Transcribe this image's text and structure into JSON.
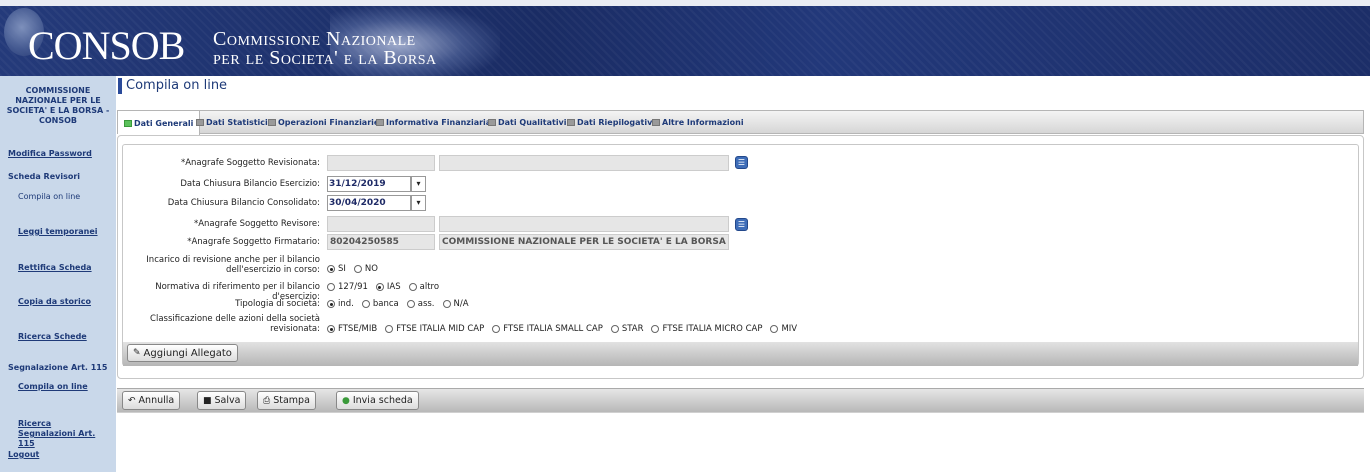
{
  "header": {
    "logo_text": "CONSOB",
    "subtitle_line1": "Commissione Nazionale",
    "subtitle_line2": "per le Societa' e la Borsa"
  },
  "sidebar": {
    "org_title": "COMMISSIONE NAZIONALE PER LE SOCIETA' E LA BORSA - CONSOB",
    "items": [
      {
        "label": "Modifica Password"
      },
      {
        "label": "Scheda Revisori"
      },
      {
        "label": "Compila on line"
      },
      {
        "label": "Leggi temporanei"
      },
      {
        "label": "Rettifica Scheda"
      },
      {
        "label": "Copia da storico"
      },
      {
        "label": "Ricerca Schede"
      },
      {
        "label": "Segnalazione Art. 115"
      },
      {
        "label": "Compila on line"
      },
      {
        "label": "Ricerca Segnalazioni Art. 115"
      },
      {
        "label": "Logout"
      }
    ]
  },
  "page": {
    "title": "Compila on line"
  },
  "tabs": [
    {
      "label": "Dati Generali",
      "active": true
    },
    {
      "label": "Dati Statistici"
    },
    {
      "label": "Operazioni Finanziarie"
    },
    {
      "label": "Informativa Finanziaria"
    },
    {
      "label": "Dati Qualitativi"
    },
    {
      "label": "Dati Riepilogativi"
    },
    {
      "label": "Altre Informazioni"
    }
  ],
  "form": {
    "anagrafe_revisionata_label": "*Anagrafe Soggetto Revisionata:",
    "data_chiusura_esercizio_label": "Data Chiusura Bilancio Esercizio:",
    "data_chiusura_esercizio_value": "31/12/2019",
    "data_chiusura_consolidato_label": "Data Chiusura Bilancio Consolidato:",
    "data_chiusura_consolidato_value": "30/04/2020",
    "anagrafe_revisore_label": "*Anagrafe Soggetto Revisore:",
    "anagrafe_firmatario_label": "*Anagrafe Soggetto Firmatario:",
    "firmatario_code": "80204250585",
    "firmatario_name": "COMMISSIONE NAZIONALE PER LE SOCIETA' E LA BORSA - C",
    "incarico_label": "Incarico di revisione anche per il bilancio dell'esercizio in corso:",
    "incarico_options": [
      "SI",
      "NO"
    ],
    "incarico_selected": "SI",
    "normativa_label": "Normativa di riferimento per il bilancio d'esercizio:",
    "normativa_options": [
      "127/91",
      "IAS",
      "altro"
    ],
    "normativa_selected": "IAS",
    "tipologia_label": "Tipologia di società:",
    "tipologia_options": [
      "ind.",
      "banca",
      "ass.",
      "N/A"
    ],
    "tipologia_selected": "ind.",
    "classificazione_label": "Classificazione delle azioni della società revisionata:",
    "classificazione_options": [
      "FTSE/MIB",
      "FTSE ITALIA MID CAP",
      "FTSE ITALIA SMALL CAP",
      "STAR",
      "FTSE ITALIA MICRO CAP",
      "MIV"
    ],
    "classificazione_selected": "FTSE/MIB",
    "aggiungi_allegato": "Aggiungi Allegato"
  },
  "actions": {
    "annulla": "Annulla",
    "salva": "Salva",
    "stampa": "Stampa",
    "invia": "Invia scheda"
  },
  "colors": {
    "header_bg": "#1d2f69",
    "sidebar_bg": "#c9d8ea",
    "link": "#1e3a78",
    "active_tab_icon": "#5cc15c"
  }
}
